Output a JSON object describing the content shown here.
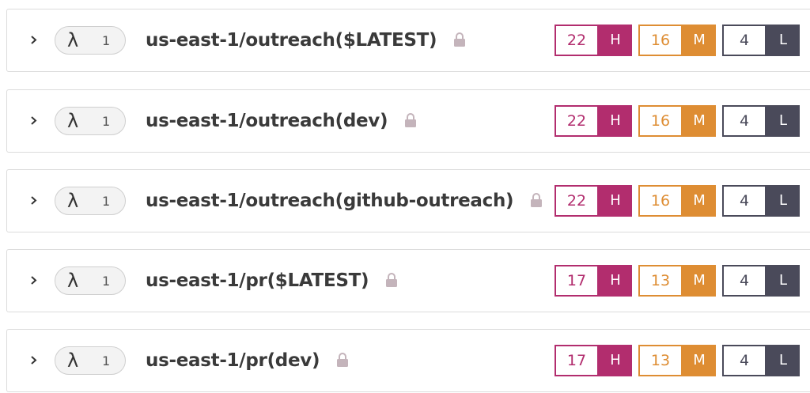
{
  "colors": {
    "high": "#b22d6e",
    "medium": "#de8d33",
    "low": "#4a4a5a"
  },
  "functions": [
    {
      "runtime_icon": "λ",
      "version_count": "1",
      "name": "us-east-1/outreach($LATEST)",
      "lock_icon": "lock-icon",
      "high_count": "22",
      "high_label": "H",
      "medium_count": "16",
      "medium_label": "M",
      "low_count": "4",
      "low_label": "L"
    },
    {
      "runtime_icon": "λ",
      "version_count": "1",
      "name": "us-east-1/outreach(dev)",
      "lock_icon": "lock-icon",
      "high_count": "22",
      "high_label": "H",
      "medium_count": "16",
      "medium_label": "M",
      "low_count": "4",
      "low_label": "L"
    },
    {
      "runtime_icon": "λ",
      "version_count": "1",
      "name": "us-east-1/outreach(github-outreach)",
      "lock_icon": "lock-icon",
      "high_count": "22",
      "high_label": "H",
      "medium_count": "16",
      "medium_label": "M",
      "low_count": "4",
      "low_label": "L"
    },
    {
      "runtime_icon": "λ",
      "version_count": "1",
      "name": "us-east-1/pr($LATEST)",
      "lock_icon": "lock-icon",
      "high_count": "17",
      "high_label": "H",
      "medium_count": "13",
      "medium_label": "M",
      "low_count": "4",
      "low_label": "L"
    },
    {
      "runtime_icon": "λ",
      "version_count": "1",
      "name": "us-east-1/pr(dev)",
      "lock_icon": "lock-icon",
      "high_count": "17",
      "high_label": "H",
      "medium_count": "13",
      "medium_label": "M",
      "low_count": "4",
      "low_label": "L"
    }
  ]
}
